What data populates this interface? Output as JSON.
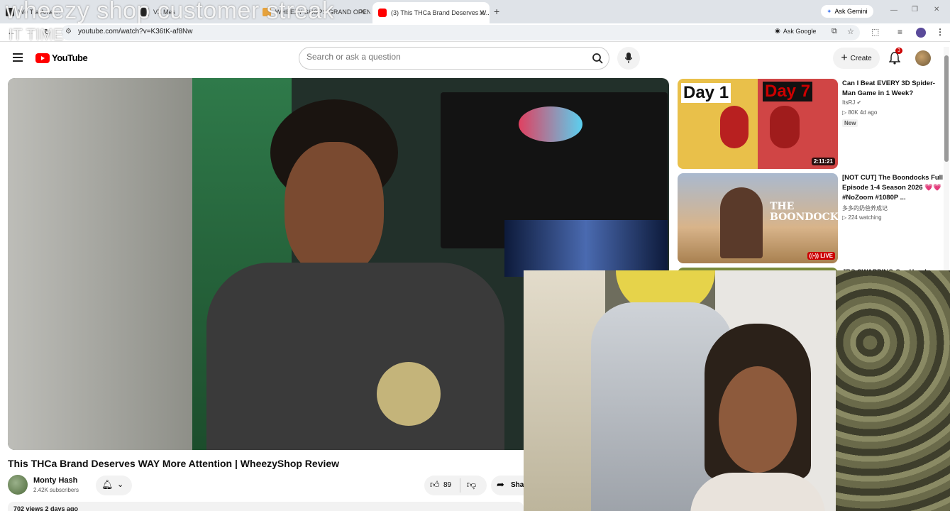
{
  "browser": {
    "tabs": [
      {
        "label": "We Tra Amer..."
      },
      {
        "label": "VZ Mes"
      },
      {
        "label": "WHEEZY SHOPS GRAND OPENI..."
      },
      {
        "label": "(3) This THCa Brand Deserves W..."
      }
    ],
    "ask_gemini": "Ask Gemini",
    "ask_google": "Ask Google",
    "url": "youtube.com/watch?v=K36tK-af8Nw"
  },
  "stream_overlay": {
    "line1": "wheezy shop customer streak",
    "line2": "IT TIME"
  },
  "youtube": {
    "logo": "YouTube",
    "search_placeholder": "Search or ask a question",
    "create_label": "Create",
    "notif_count": "3"
  },
  "video": {
    "title": "This THCa Brand Deserves WAY More Attention | WheezyShop Review",
    "channel": "Monty Hash",
    "subscribers": "2.42K subscribers",
    "likes": "89",
    "share_label": "Share",
    "views_partial": "702 views  2 days ago"
  },
  "recommendations": [
    {
      "title": "Can I Beat EVERY 3D Spider-Man Game in 1 Week?",
      "channel": "ItsRJ",
      "meta": "80K  4d ago",
      "badge": "New",
      "duration": "2:11:21",
      "thumb_text1": "Day 1",
      "thumb_text2": "Day 7"
    },
    {
      "title": "[NOT CUT] The Boondocks Full Episode 1-4 Season 2026 💗💗 #NoZoom #1080P ...",
      "channel": "多多的奶爸养成记",
      "meta": "224 watching",
      "live": "LIVE",
      "thumb_text": "THE BOONDOCKS"
    },
    {
      "title": "JRS SWAPPING Our Hondo..."
    }
  ],
  "colors": {
    "yt_red": "#ff0000",
    "tabstrip": "#dfe3e8",
    "notif": "#cc0000"
  }
}
